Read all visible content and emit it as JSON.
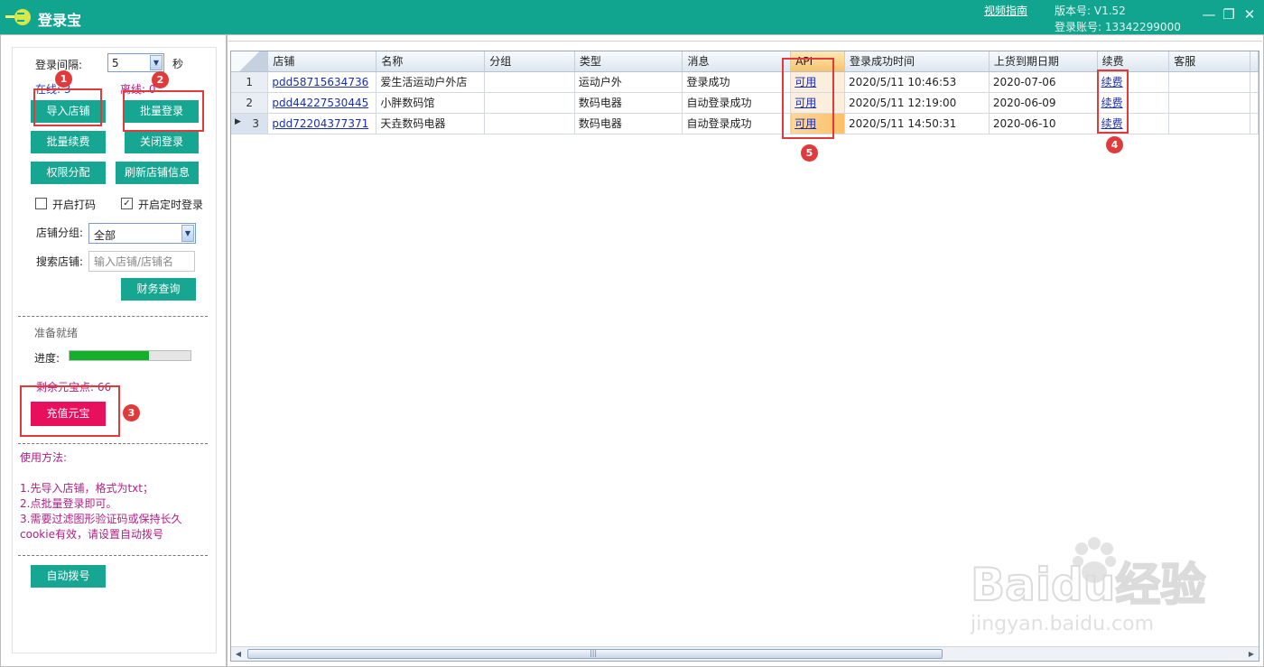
{
  "app": {
    "title": "登录宝",
    "video_guide": "视频指南",
    "version": "版本号: V1.52",
    "account": "登录账号: 13342299000"
  },
  "left": {
    "interval_label": "登录间隔:",
    "interval_value": "5",
    "interval_unit": "秒",
    "online": "在线: 3",
    "offline": "离线: 0",
    "buttons": {
      "import": "导入店铺",
      "batch_login": "批量登录",
      "batch_renew": "批量续费",
      "close_login": "关闭登录",
      "permission": "权限分配",
      "refresh": "刷新店铺信息",
      "finance": "财务查询",
      "recharge": "充值元宝",
      "auto_dial": "自动拨号"
    },
    "check_captcha": "开启打码",
    "check_timed": "开启定时登录",
    "group_label": "店铺分组:",
    "group_value": "全部",
    "search_label": "搜索店铺:",
    "search_placeholder": "输入店铺/店铺名",
    "ready": "准备就绪",
    "progress_label": "进度:",
    "progress_fraction": 0.66,
    "remaining": "剩余元宝点: 66",
    "usage_title": "使用方法:",
    "usage_lines": [
      "1.先导入店铺，格式为txt；",
      "2.点批量登录即可。",
      "3.需要过滤图形验证码或保持长久",
      "cookie有效，请设置自动拨号"
    ]
  },
  "annotations": [
    "1",
    "2",
    "3",
    "4",
    "5"
  ],
  "grid": {
    "columns": [
      "店铺",
      "名称",
      "分组",
      "类型",
      "消息",
      "API",
      "登录成功时间",
      "上货到期日期",
      "续费",
      "客服"
    ],
    "rows": [
      {
        "no": "1",
        "shop": "pdd58715634736",
        "name": "爱生活运动户外店",
        "group": "",
        "type": "运动户外",
        "message": "登录成功",
        "api": "可用",
        "login_time": "2020/5/11 10:46:53",
        "expire": "2020-07-06",
        "renew": "续费",
        "service": ""
      },
      {
        "no": "2",
        "shop": "pdd44227530445",
        "name": "小胖数码馆",
        "group": "",
        "type": "数码电器",
        "message": "自动登录成功",
        "api": "可用",
        "login_time": "2020/5/11 12:19:00",
        "expire": "2020-06-09",
        "renew": "续费",
        "service": ""
      },
      {
        "no": "3",
        "shop": "pdd72204377371",
        "name": "天垚数码电器",
        "group": "",
        "type": "数码电器",
        "message": "自动登录成功",
        "api": "可用",
        "login_time": "2020/5/11 14:50:31",
        "expire": "2020-06-10",
        "renew": "续费",
        "service": ""
      }
    ],
    "scroll_mid": "|||"
  },
  "watermark": {
    "brand": "Baidu经验",
    "url": "jingyan.baidu.com"
  },
  "colors": {
    "titlebar": "#11a48f",
    "button": "#16a691",
    "recharge": "#e8105d",
    "annotation": "#e03a3a",
    "progress": "#13b12a"
  }
}
